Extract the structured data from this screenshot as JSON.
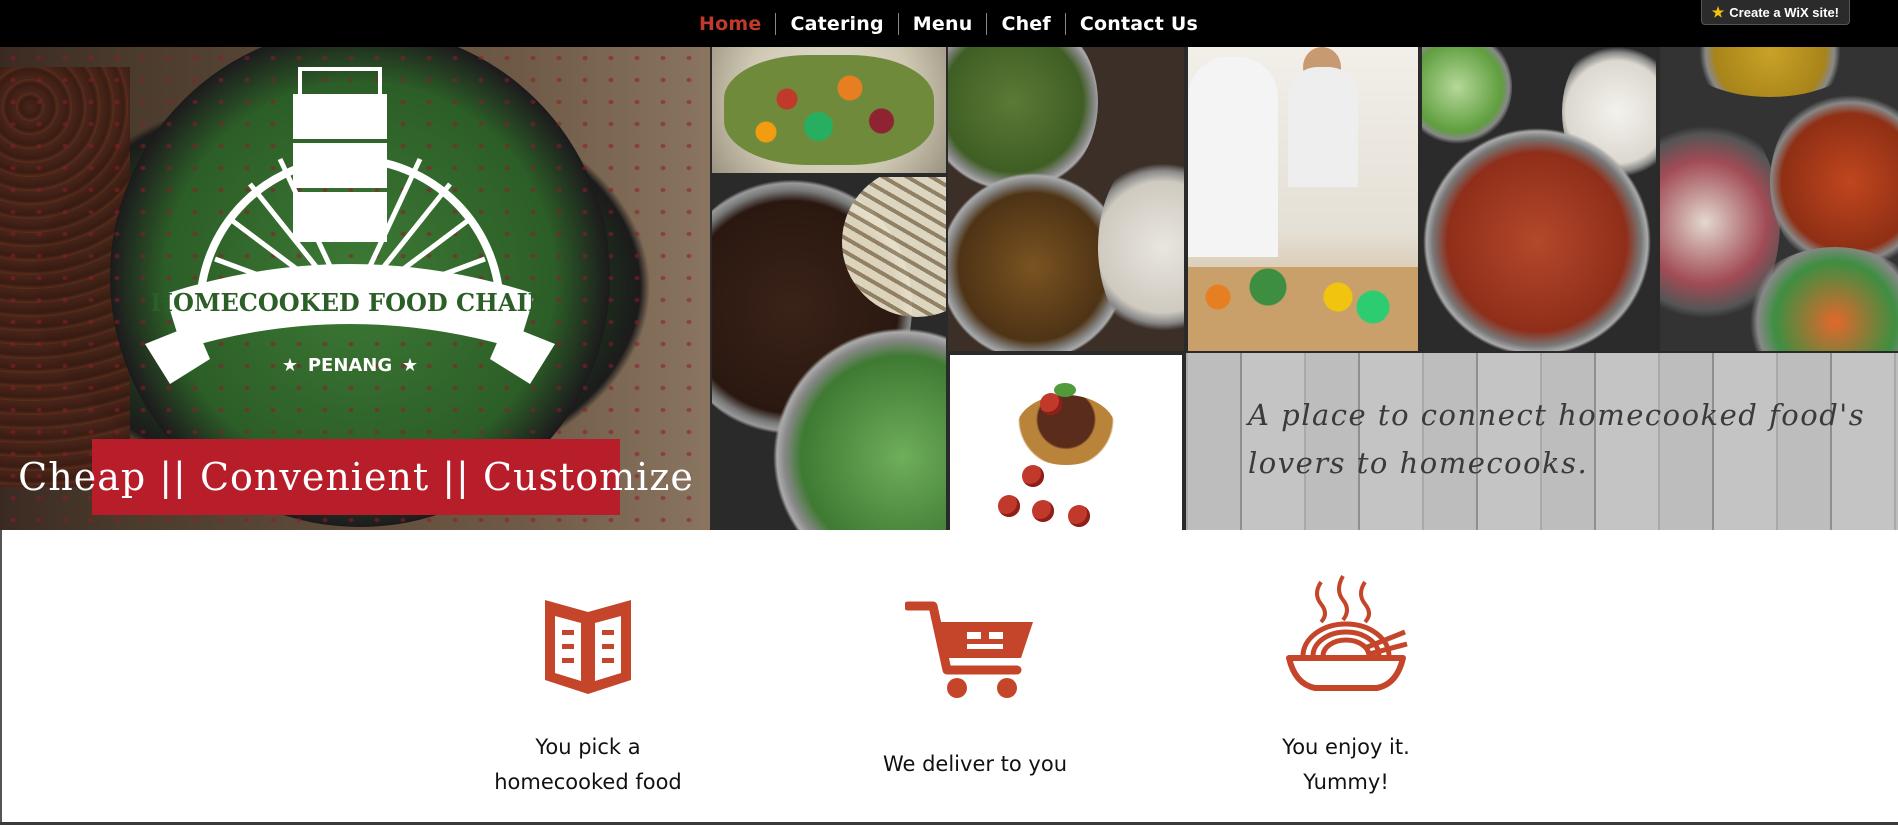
{
  "nav": {
    "items": [
      {
        "label": "Home",
        "active": true
      },
      {
        "label": "Catering",
        "active": false
      },
      {
        "label": "Menu",
        "active": false
      },
      {
        "label": "Chef",
        "active": false
      },
      {
        "label": "Contact Us",
        "active": false
      }
    ]
  },
  "wix_badge": {
    "label": "Create a WiX site!",
    "icon": "wix-star-icon"
  },
  "hero": {
    "logo": {
      "line1": "HOMECOOKED FOOD CHAIN",
      "line2": "PENANG"
    },
    "tagline": "Cheap || Convenient || Customize",
    "slogan": "A place to connect homecooked food's lovers to  homecooks."
  },
  "steps": [
    {
      "icon": "menu-book-icon",
      "label_line1": "You pick a",
      "label_line2": "homecooked food"
    },
    {
      "icon": "shopping-cart-icon",
      "label_line1": "We deliver to you",
      "label_line2": ""
    },
    {
      "icon": "noodle-bowl-icon",
      "label_line1": "You enjoy it.",
      "label_line2": "Yummy!"
    }
  ],
  "colors": {
    "accent": "#c0392b",
    "icon": "#c4452a",
    "tagline_bg": "#b81d2a",
    "nav_bg": "#000000"
  }
}
